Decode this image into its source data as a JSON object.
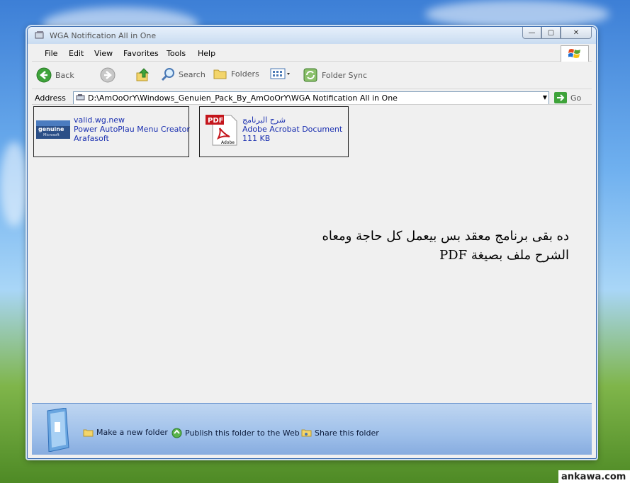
{
  "window": {
    "title": "WGA Notification All in One",
    "caption_buttons": {
      "minimize": "—",
      "maximize": "▢",
      "close": "✕"
    }
  },
  "menu": [
    "File",
    "Edit",
    "View",
    "Favorites",
    "Tools",
    "Help"
  ],
  "toolbar": {
    "back": "Back",
    "search": "Search",
    "folders": "Folders",
    "folder_sync": "Folder Sync"
  },
  "address": {
    "label": "Address",
    "path": "D:\\AmOoOrY\\Windows_Genuien_Pack_By_AmOoOrY\\WGA Notification All in One",
    "go": "Go"
  },
  "files": [
    {
      "name": "valid.wg.new",
      "line2": "Power AutoPlau Menu Creator",
      "line3": "Arafasoft",
      "icon": "genuine-microsoft-icon"
    },
    {
      "name": "شرح البرنامج",
      "line2": "Adobe Acrobat Document",
      "line3": "111 KB",
      "icon": "pdf-icon"
    }
  ],
  "note": {
    "line1": "ده بقى برنامج معقد بس بيعمل كل حاجة ومعاه",
    "line2": "الشرح ملف بصيغة PDF"
  },
  "tasks": {
    "new_folder": "Make a new folder",
    "publish": "Publish this folder to the Web",
    "share": "Share this folder"
  },
  "watermark": "ankawa.com",
  "colors": {
    "link": "#1a2fb0",
    "accent": "#3a6bb0"
  }
}
